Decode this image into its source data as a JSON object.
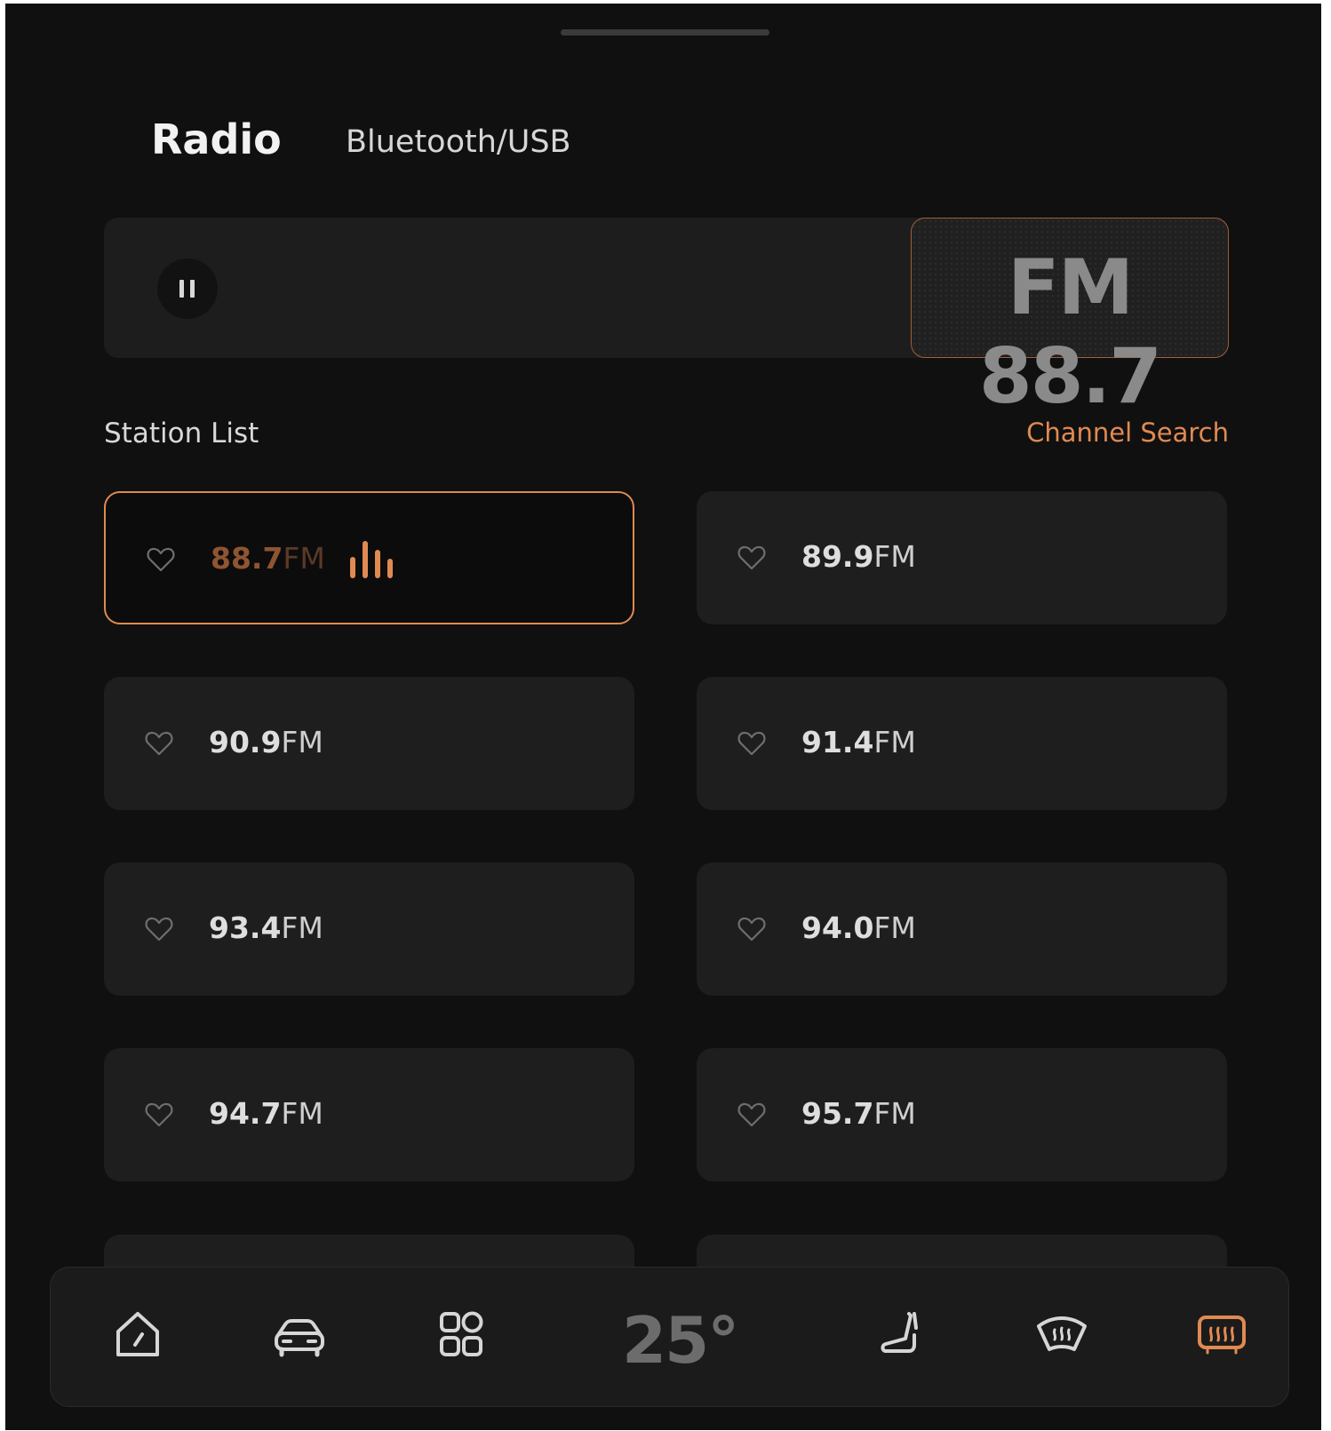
{
  "tabs": {
    "radio": "Radio",
    "bluetooth_usb": "Bluetooth/USB"
  },
  "player": {
    "display": "FM 88.7",
    "state": "playing"
  },
  "station_list": {
    "title": "Station List",
    "search_label": "Channel Search",
    "stations": [
      {
        "freq": "88.7",
        "unit": "FM",
        "active": true
      },
      {
        "freq": "89.9",
        "unit": "FM",
        "active": false
      },
      {
        "freq": "90.9",
        "unit": "FM",
        "active": false
      },
      {
        "freq": "91.4",
        "unit": "FM",
        "active": false
      },
      {
        "freq": "93.4",
        "unit": "FM",
        "active": false
      },
      {
        "freq": "94.0",
        "unit": "FM",
        "active": false
      },
      {
        "freq": "94.7",
        "unit": "FM",
        "active": false
      },
      {
        "freq": "95.7",
        "unit": "FM",
        "active": false
      }
    ]
  },
  "dock": {
    "icons": [
      "home-icon",
      "car-icon",
      "apps-icon",
      "seat-icon",
      "front-defrost-icon",
      "rear-defrost-icon"
    ],
    "temperature": "25°",
    "active_icon": "rear-defrost-icon"
  },
  "colors": {
    "accent": "#e08a52",
    "background": "#101010",
    "card": "#1e1e1e"
  }
}
